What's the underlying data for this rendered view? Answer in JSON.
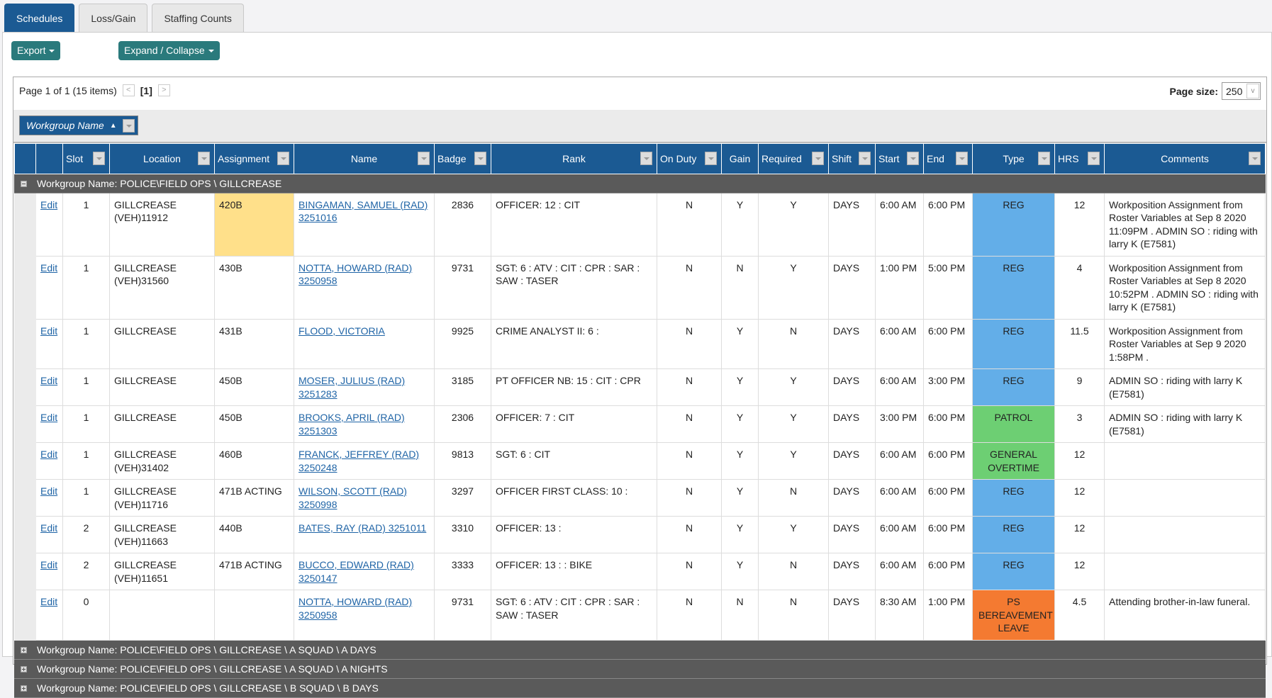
{
  "tabs": [
    {
      "label": "Schedules",
      "active": true
    },
    {
      "label": "Loss/Gain"
    },
    {
      "label": "Staffing Counts"
    }
  ],
  "toolbar": {
    "export": "Export",
    "expand": "Expand / Collapse"
  },
  "pager": {
    "info": "Page 1 of 1 (15 items)",
    "current": "[1]",
    "page_size_label": "Page size:",
    "page_size": "250"
  },
  "group_chip": "Workgroup Name",
  "columns": [
    "",
    "",
    "Slot",
    "Location",
    "Assignment",
    "Name",
    "Badge",
    "Rank",
    "On Duty",
    "Gain",
    "Required",
    "Shift",
    "Start",
    "End",
    "Type",
    "HRS",
    "Comments"
  ],
  "colors": {
    "REG": "#63aee8",
    "PATROL": "#6dcf73",
    "GENERAL OVERTIME": "#6dcf73",
    "PS BEREAVEMENT LEAVE": "#f47a31",
    "highlight": "#ffe08a",
    "header": "#1b5a93",
    "group": "#5a5a5a"
  },
  "groups": [
    {
      "label": "Workgroup Name: POLICE\\FIELD OPS \\ GILLCREASE",
      "expanded": true,
      "rows": [
        {
          "edit": "Edit",
          "slot": "1",
          "location": "GILLCREASE (VEH)11912",
          "assignment": "420B",
          "highlight": true,
          "name": "BINGAMAN, SAMUEL (RAD) 3251016",
          "badge": "2836",
          "rank": "OFFICER: 12 : CIT",
          "on_duty": "N",
          "gain": "Y",
          "required": "Y",
          "shift": "DAYS",
          "start": "6:00 AM",
          "end": "6:00 PM",
          "type": "REG",
          "hrs": "12",
          "comments": "Workposition Assignment from Roster Variables at Sep 8 2020 11:09PM . ADMIN SO : riding with larry K (E7581)"
        },
        {
          "edit": "Edit",
          "slot": "1",
          "location": "GILLCREASE (VEH)31560",
          "assignment": "430B",
          "name": "NOTTA, HOWARD (RAD) 3250958",
          "badge": "9731",
          "rank": "SGT: 6 : ATV : CIT : CPR : SAR : SAW : TASER",
          "on_duty": "N",
          "gain": "N",
          "required": "Y",
          "shift": "DAYS",
          "start": "1:00 PM",
          "end": "5:00 PM",
          "type": "REG",
          "hrs": "4",
          "comments": "Workposition Assignment from Roster Variables at Sep 8 2020 10:52PM . ADMIN SO : riding with larry K (E7581)"
        },
        {
          "edit": "Edit",
          "slot": "1",
          "location": "GILLCREASE",
          "assignment": "431B",
          "name": "FLOOD, VICTORIA",
          "badge": "9925",
          "rank": "CRIME ANALYST II: 6 :",
          "on_duty": "N",
          "gain": "Y",
          "required": "N",
          "shift": "DAYS",
          "start": "6:00 AM",
          "end": "6:00 PM",
          "type": "REG",
          "hrs": "11.5",
          "comments": "Workposition Assignment from Roster Variables at Sep 9 2020 1:58PM ."
        },
        {
          "edit": "Edit",
          "slot": "1",
          "location": "GILLCREASE",
          "assignment": "450B",
          "name": "MOSER, JULIUS (RAD) 3251283",
          "badge": "3185",
          "rank": "PT OFFICER NB: 15 : CIT : CPR",
          "on_duty": "N",
          "gain": "Y",
          "required": "Y",
          "shift": "DAYS",
          "start": "6:00 AM",
          "end": "3:00 PM",
          "type": "REG",
          "hrs": "9",
          "comments": "ADMIN SO : riding with larry K (E7581)"
        },
        {
          "edit": "Edit",
          "slot": "1",
          "location": "GILLCREASE",
          "assignment": "450B",
          "name": "BROOKS, APRIL (RAD) 3251303",
          "badge": "2306",
          "rank": "OFFICER: 7 : CIT",
          "on_duty": "N",
          "gain": "Y",
          "required": "Y",
          "shift": "DAYS",
          "start": "3:00 PM",
          "end": "6:00 PM",
          "type": "PATROL",
          "hrs": "3",
          "comments": "ADMIN SO : riding with larry K (E7581)"
        },
        {
          "edit": "Edit",
          "slot": "1",
          "location": "GILLCREASE (VEH)31402",
          "assignment": "460B",
          "name": "FRANCK, JEFFREY (RAD) 3250248",
          "badge": "9813",
          "rank": "SGT: 6 : CIT",
          "on_duty": "N",
          "gain": "Y",
          "required": "Y",
          "shift": "DAYS",
          "start": "6:00 AM",
          "end": "6:00 PM",
          "type": "GENERAL OVERTIME",
          "hrs": "12",
          "comments": ""
        },
        {
          "edit": "Edit",
          "slot": "1",
          "location": "GILLCREASE (VEH)11716",
          "assignment": "471B ACTING",
          "name": "WILSON, SCOTT (RAD) 3250998",
          "badge": "3297",
          "rank": "OFFICER FIRST CLASS: 10 :",
          "on_duty": "N",
          "gain": "Y",
          "required": "N",
          "shift": "DAYS",
          "start": "6:00 AM",
          "end": "6:00 PM",
          "type": "REG",
          "hrs": "12",
          "comments": ""
        },
        {
          "edit": "Edit",
          "slot": "2",
          "location": "GILLCREASE (VEH)11663",
          "assignment": "440B",
          "name": "BATES, RAY (RAD) 3251011",
          "badge": "3310",
          "rank": "OFFICER: 13 :",
          "on_duty": "N",
          "gain": "Y",
          "required": "Y",
          "shift": "DAYS",
          "start": "6:00 AM",
          "end": "6:00 PM",
          "type": "REG",
          "hrs": "12",
          "comments": ""
        },
        {
          "edit": "Edit",
          "slot": "2",
          "location": "GILLCREASE (VEH)11651",
          "assignment": "471B ACTING",
          "name": "BUCCO, EDWARD (RAD) 3250147",
          "badge": "3333",
          "rank": "OFFICER: 13 : : BIKE",
          "on_duty": "N",
          "gain": "Y",
          "required": "N",
          "shift": "DAYS",
          "start": "6:00 AM",
          "end": "6:00 PM",
          "type": "REG",
          "hrs": "12",
          "comments": ""
        },
        {
          "edit": "Edit",
          "slot": "0",
          "location": "",
          "assignment": "",
          "name": "NOTTA, HOWARD (RAD) 3250958",
          "badge": "9731",
          "rank": "SGT: 6 : ATV : CIT : CPR : SAR : SAW : TASER",
          "on_duty": "N",
          "gain": "N",
          "required": "N",
          "shift": "DAYS",
          "start": "8:30 AM",
          "end": "1:00 PM",
          "type": "PS BEREAVEMENT LEAVE",
          "hrs": "4.5",
          "comments": "Attending brother-in-law funeral."
        }
      ]
    },
    {
      "label": "Workgroup Name: POLICE\\FIELD OPS \\ GILLCREASE \\ A SQUAD \\ A DAYS",
      "expanded": false,
      "rows": []
    },
    {
      "label": "Workgroup Name: POLICE\\FIELD OPS \\ GILLCREASE \\ A SQUAD \\ A NIGHTS",
      "expanded": false,
      "rows": []
    },
    {
      "label": "Workgroup Name: POLICE\\FIELD OPS \\ GILLCREASE \\ B SQUAD \\ B DAYS",
      "expanded": false,
      "rows": []
    }
  ]
}
